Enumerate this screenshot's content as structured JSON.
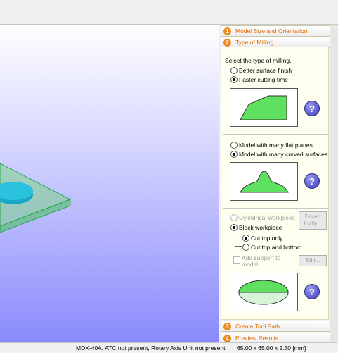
{
  "steps": [
    {
      "num": "1",
      "label": "Model Size and Orientation"
    },
    {
      "num": "2",
      "label": "Type of Milling"
    },
    {
      "num": "3",
      "label": "Create Tool Path"
    },
    {
      "num": "4",
      "label": "Preview Results"
    }
  ],
  "milling": {
    "prompt": "Select the type of milling.",
    "finish_option": "Better surface finish",
    "faster_option": "Faster cutting time",
    "flat_option": "Model with many flat planes",
    "curved_option": "Model with many curved surfaces",
    "cylindrical_option": "Cylindrical workpiece",
    "block_option": "Block workpiece",
    "eccentricity_button_1": "Eccen",
    "eccentricity_button_2": "tricity...",
    "cut_top_option": "Cut top only",
    "cut_both_option": "Cut top and bottom",
    "support_label_1": "Add support to",
    "support_label_2": "model",
    "edit_button": "Edit...",
    "help_glyph": "?"
  },
  "status": {
    "machine": "MDX-40A, ATC not present, Rotary Axis Unit not present",
    "size": "65.00 x  65.00 x  2.50 [mm]"
  },
  "colors": {
    "step_number": "#f08a1a",
    "step_label": "#e06a00",
    "model_green": "#5fe05f",
    "model_cyan": "#1ab3d0"
  }
}
